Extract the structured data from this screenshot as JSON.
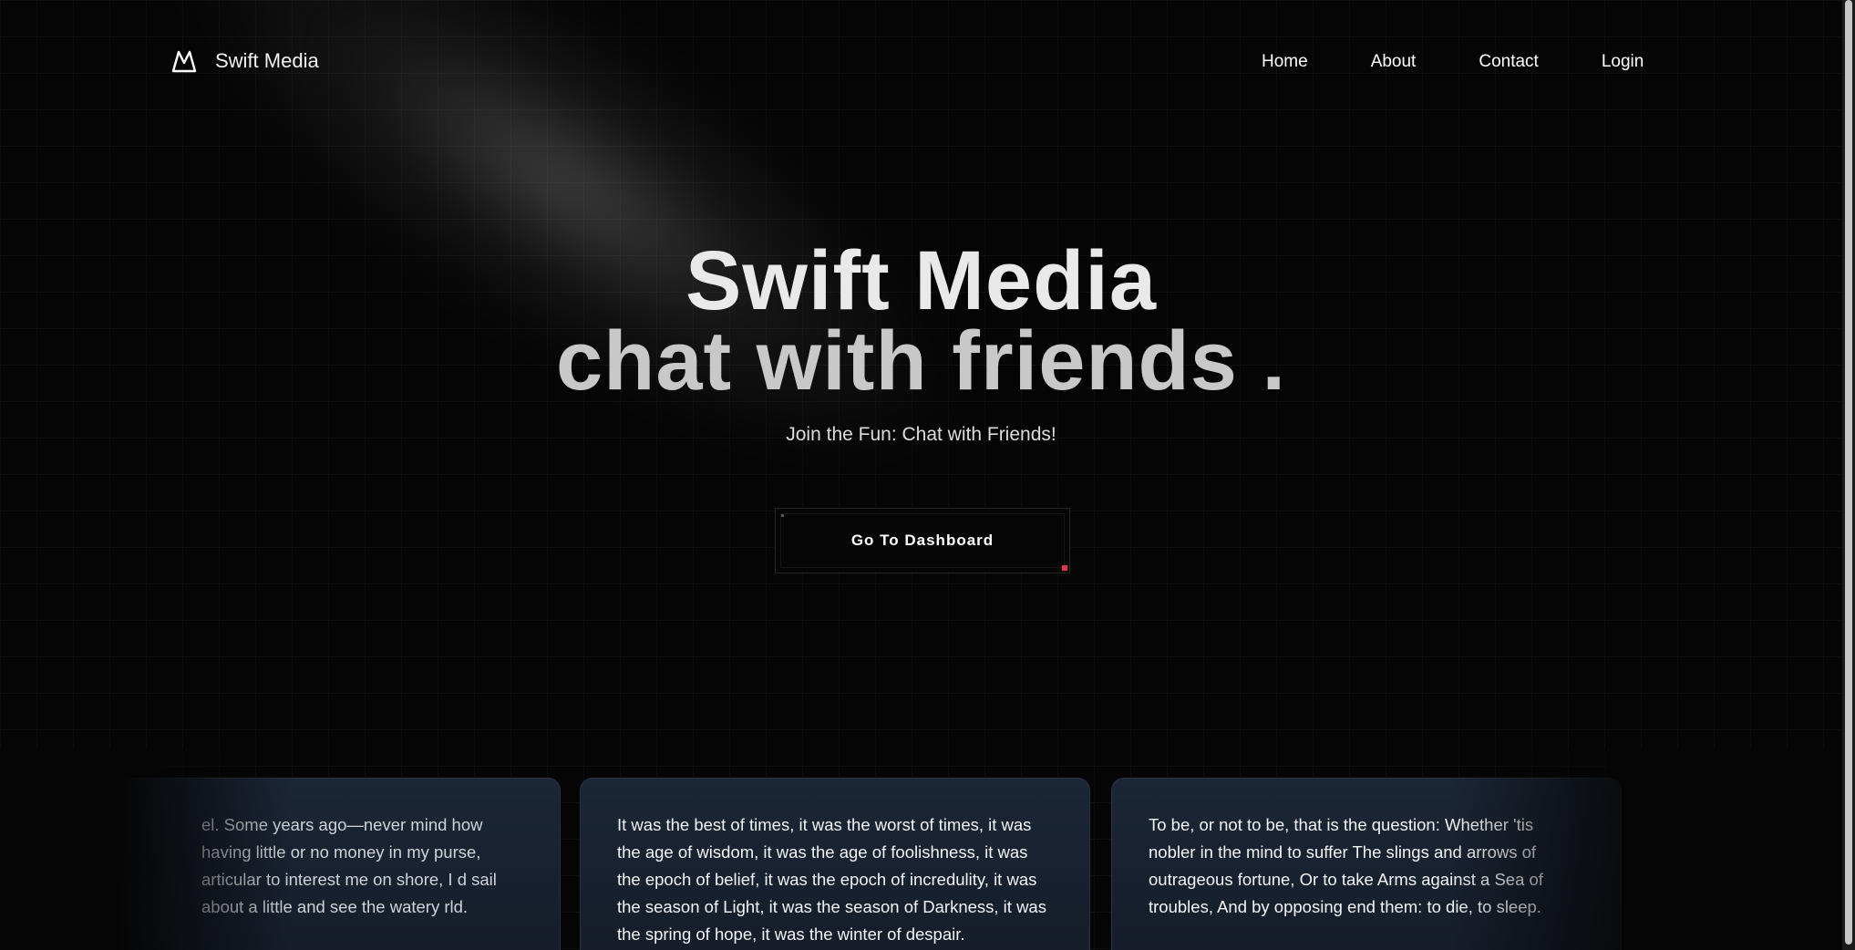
{
  "brand": {
    "name": "Swift Media",
    "logo_icon": "mountain-icon"
  },
  "nav": {
    "items": [
      "Home",
      "About",
      "Contact",
      "Login"
    ]
  },
  "hero": {
    "title_line1": "Swift Media",
    "title_line2": "chat with friends .",
    "subtitle": "Join the Fun: Chat with Friends!",
    "cta_label": "Go To Dashboard"
  },
  "cards": [
    {
      "text": "el. Some years ago—never mind how having little or no money in my purse, articular to interest me on shore, I d sail about a little and see the watery rld."
    },
    {
      "text": "It was the best of times, it was the worst of times, it was the age of wisdom, it was the age of foolishness, it was the epoch of belief, it was the epoch of incredulity, it was the season of Light, it was the season of Darkness, it was the spring of hope, it was the winter of despair."
    },
    {
      "text": "To be, or not to be, that is the question: Whether 'tis nobler in the mind to suffer The slings and arrows of outrageous fortune, Or to take Arms against a Sea of troubles, And by opposing end them: to die, to sleep."
    }
  ],
  "colors": {
    "background": "#050505",
    "card_background": "#1b2636",
    "accent_dot": "#e0344b"
  }
}
